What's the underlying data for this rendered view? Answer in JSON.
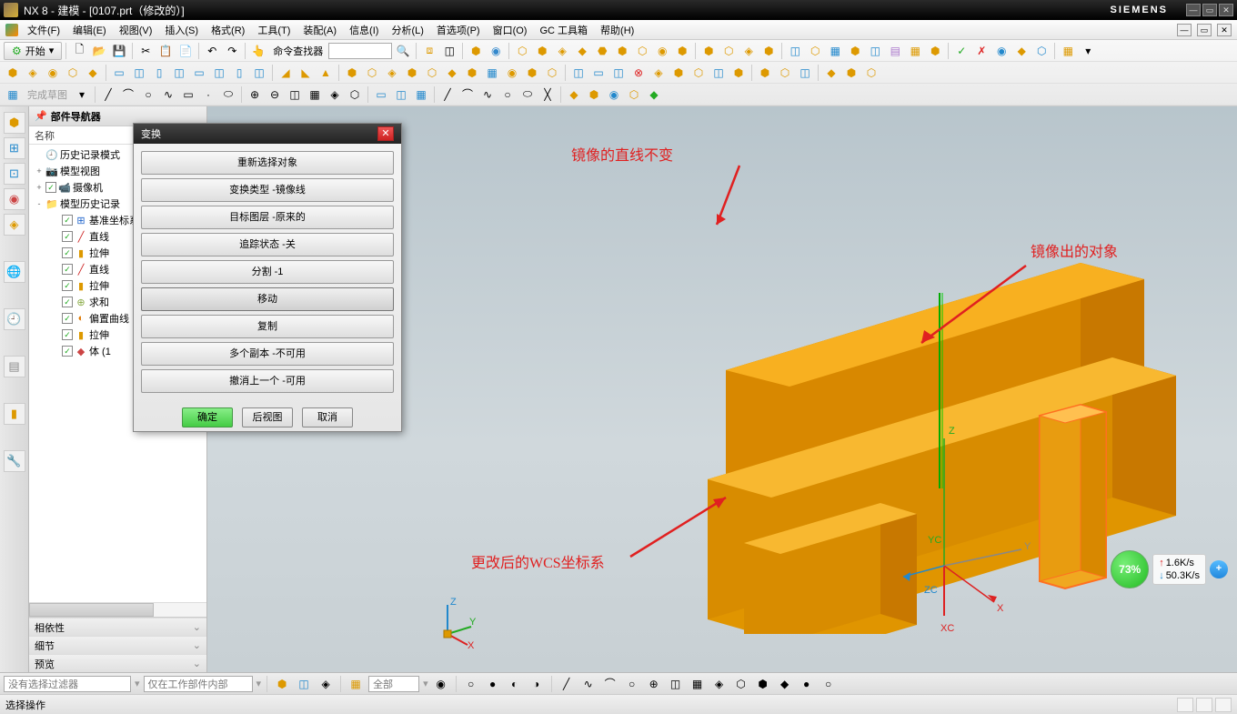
{
  "window": {
    "title": "NX 8 - 建模 - [0107.prt（修改的）]",
    "brand": "SIEMENS"
  },
  "menu": {
    "items": [
      "文件(F)",
      "编辑(E)",
      "视图(V)",
      "插入(S)",
      "格式(R)",
      "工具(T)",
      "装配(A)",
      "信息(I)",
      "分析(L)",
      "首选项(P)",
      "窗口(O)",
      "GC 工具箱",
      "帮助(H)"
    ]
  },
  "toolbar": {
    "start": "开始",
    "cmd_finder_label": "命令查找器",
    "cmd_finder_placeholder": "",
    "finish_sketch": "完成草图"
  },
  "navigator": {
    "title": "部件导航器",
    "col_name": "名称",
    "items": [
      {
        "label": "历史记录模式",
        "icon": "🕘",
        "indent": 0,
        "exp": "",
        "chk": false
      },
      {
        "label": "模型视图",
        "icon": "📷",
        "indent": 0,
        "exp": "+",
        "chk": false,
        "color": "#2a8"
      },
      {
        "label": "摄像机",
        "icon": "📹",
        "indent": 0,
        "exp": "+",
        "chk": true,
        "color": "#d08"
      },
      {
        "label": "模型历史记录",
        "icon": "📁",
        "indent": 0,
        "exp": "-",
        "chk": false,
        "color": "#d90"
      },
      {
        "label": "基准坐标系",
        "icon": "⊞",
        "indent": 1,
        "exp": "",
        "chk": true,
        "color": "#26c"
      },
      {
        "label": "直线",
        "icon": "╱",
        "indent": 1,
        "exp": "",
        "chk": true,
        "color": "#c22"
      },
      {
        "label": "拉伸",
        "icon": "▮",
        "indent": 1,
        "exp": "",
        "chk": true,
        "color": "#d90"
      },
      {
        "label": "直线",
        "icon": "╱",
        "indent": 1,
        "exp": "",
        "chk": true,
        "color": "#c22"
      },
      {
        "label": "拉伸",
        "icon": "▮",
        "indent": 1,
        "exp": "",
        "chk": true,
        "color": "#d90"
      },
      {
        "label": "求和",
        "icon": "⊕",
        "indent": 1,
        "exp": "",
        "chk": true,
        "color": "#8a4"
      },
      {
        "label": "偏置曲线",
        "icon": "◐",
        "indent": 1,
        "exp": "",
        "chk": true,
        "color": "#d70"
      },
      {
        "label": "拉伸",
        "icon": "▮",
        "indent": 1,
        "exp": "",
        "chk": true,
        "color": "#d90"
      },
      {
        "label": "体 (1",
        "icon": "◆",
        "indent": 1,
        "exp": "",
        "chk": true,
        "color": "#c44"
      }
    ],
    "accordion": [
      "相依性",
      "细节",
      "预览"
    ]
  },
  "dialog": {
    "title": "变换",
    "rows": [
      "重新选择对象",
      "变换类型 -镜像线",
      "目标图层 -原来的",
      "追踪状态 -关",
      "分割 -1",
      "移动",
      "复制",
      "多个副本 -不可用",
      "撤消上一个 -可用"
    ],
    "selected_index": 5,
    "ok": "确定",
    "back": "后视图",
    "cancel": "取消"
  },
  "annotations": {
    "a1": "镜像的直线不变",
    "a2": "镜像出的对象",
    "a3": "更改后的WCS坐标系"
  },
  "axes": {
    "x": "X",
    "y": "Y",
    "z": "Z",
    "xc": "XC",
    "yc": "YC",
    "zc": "ZC"
  },
  "filterbar": {
    "no_filter": "没有选择过滤器",
    "scope": "仅在工作部件内部",
    "all": "全部"
  },
  "status": {
    "text": "选择操作"
  },
  "net": {
    "pct": "73%",
    "up": "1.6K/s",
    "down": "50.3K/s"
  }
}
